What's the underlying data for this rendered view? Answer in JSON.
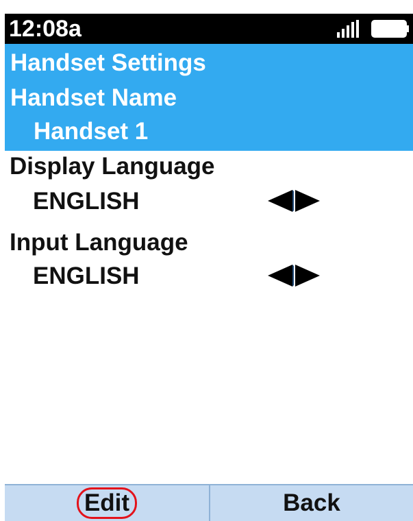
{
  "status_bar": {
    "time": "12:08a",
    "signal_icon": "signal-bars-icon",
    "battery_icon": "battery-icon"
  },
  "header": {
    "menu_title": "Handset Settings",
    "item_label": "Handset Name",
    "item_value": "Handset 1"
  },
  "settings": [
    {
      "label": "Display Language",
      "value": "ENGLISH",
      "control_icon": "left-right-arrows-icon"
    },
    {
      "label": "Input Language",
      "value": "ENGLISH",
      "control_icon": "left-right-arrows-icon"
    }
  ],
  "softkeys": {
    "left": "Edit",
    "right": "Back"
  },
  "colors": {
    "header_bg": "#33aaf0",
    "softkey_bg": "#c6dbf2",
    "highlight_ring": "#e3121b"
  }
}
